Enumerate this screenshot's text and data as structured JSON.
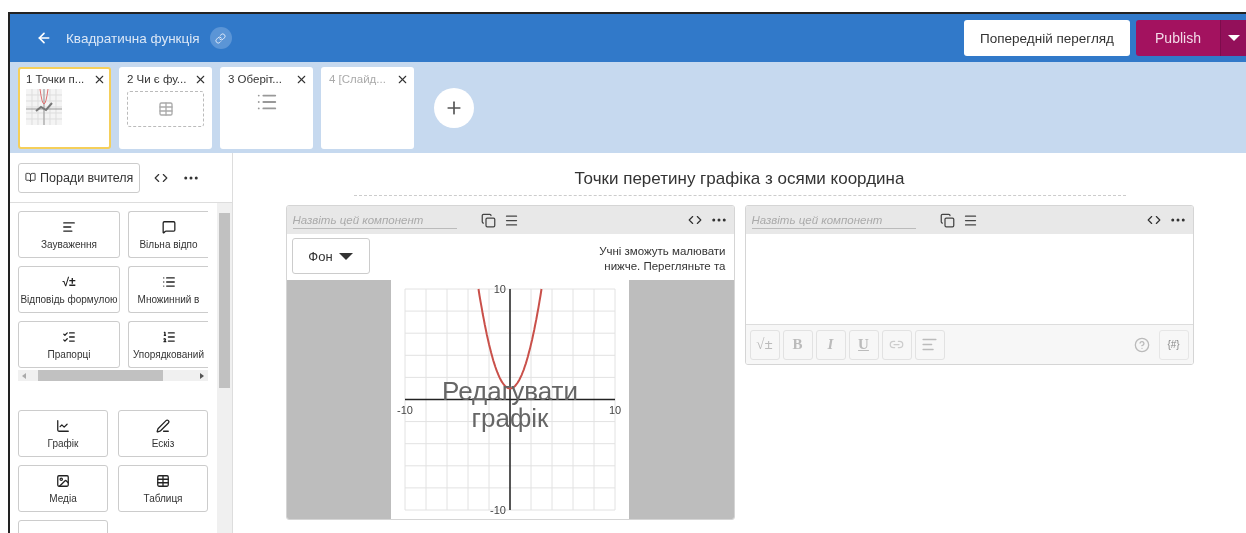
{
  "header": {
    "title": "Квадратична функція",
    "preview_button": "Попередній перегляд",
    "publish_button": "Publish"
  },
  "slides": [
    {
      "label": "1 Точки п...",
      "selected": true,
      "kind": "graph"
    },
    {
      "label": "2 Чи є фу...",
      "selected": false,
      "kind": "table"
    },
    {
      "label": "3 Оберіт...",
      "selected": false,
      "kind": "list"
    },
    {
      "label": "4 [Слайд...",
      "selected": false,
      "kind": "empty"
    }
  ],
  "sidebar": {
    "tips_button": "Поради вчителя",
    "components": [
      {
        "label": "Зауваження",
        "kind": "note"
      },
      {
        "label": "Вільна відпо",
        "kind": "free"
      },
      {
        "label": "Відповідь формулою",
        "kind": "formula",
        "icon_text": "√±"
      },
      {
        "label": "Множинний в",
        "kind": "multiple"
      },
      {
        "label": "Прапорці",
        "kind": "checkboxes"
      },
      {
        "label": "Упорядкований",
        "kind": "ordered"
      }
    ],
    "tools": [
      {
        "label": "Графік",
        "kind": "graph"
      },
      {
        "label": "Ескіз",
        "kind": "sketch"
      },
      {
        "label": "Медіа",
        "kind": "media"
      },
      {
        "label": "Таблиця",
        "kind": "table"
      },
      {
        "kind": "partial"
      }
    ]
  },
  "screen": {
    "title": "Точки перетину графіка з осями координа",
    "graph_component": {
      "name_placeholder": "Назвіть цей компонент",
      "background_button": "Фон",
      "hint": "Учні зможуть малювати нижче. Перегляньте та",
      "edit_overlay": "Редагувати графік",
      "chart_data": {
        "type": "line",
        "x": [
          -3,
          -2,
          -1,
          0,
          1,
          2,
          3
        ],
        "series": [
          {
            "color": "#c9504a",
            "values": [
              10,
              5,
              2,
              1,
              2,
              5,
              10
            ]
          }
        ],
        "xlim": [
          -10,
          10
        ],
        "ylim": [
          -10,
          10
        ],
        "xticks": [
          -10,
          10
        ],
        "yticks": [
          -10,
          10
        ]
      }
    },
    "text_component": {
      "name_placeholder": "Назвіть цей компонент",
      "toolbar": [
        {
          "kind": "text",
          "label": "√±"
        },
        {
          "kind": "bold",
          "label": "B"
        },
        {
          "kind": "italic",
          "label": "I"
        },
        {
          "kind": "underline",
          "label": "U"
        },
        {
          "kind": "link"
        },
        {
          "kind": "align"
        }
      ],
      "insert_button": "{#}"
    }
  }
}
